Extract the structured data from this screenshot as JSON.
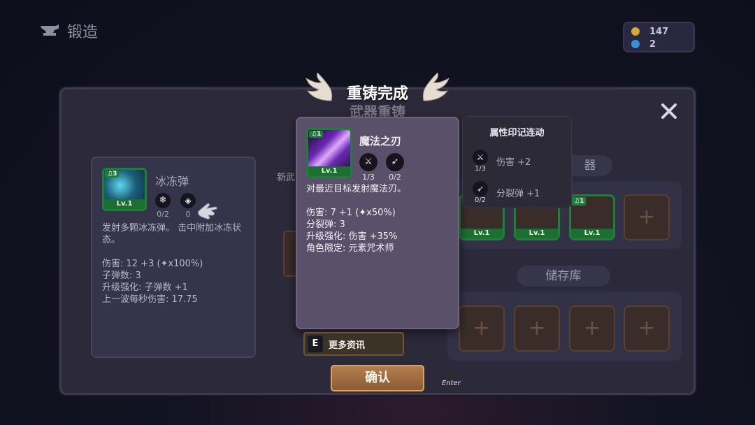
{
  "header": {
    "title": "锻造"
  },
  "currency": {
    "gold": "147",
    "gems": "2",
    "gold_color": "#d4a93a",
    "gem_color": "#3a8fd4"
  },
  "banner": {
    "title": "重铸完成",
    "subtitle": "武器重铸"
  },
  "left_card": {
    "weapon_name": "冰冻弹",
    "badge": "3",
    "level": "Lv.1",
    "mod1_count": "0/2",
    "mod2_count": "0",
    "description": "发射多颗冰冻弹。 击中附加冰冻状态。",
    "stats": [
      "伤害: 12 +3 (✦x100%)",
      "子弹数: 3",
      "升级强化: 子弹数 +1",
      "上一波每秒伤害: 17.75"
    ]
  },
  "new_weapon_label": "新武",
  "detail": {
    "badge": "1",
    "name": "魔法之刃",
    "level": "Lv.1",
    "mod1_count": "1/3",
    "mod2_count": "0/2",
    "description": "对最近目标发射魔法刃。",
    "stats": [
      "伤害: 7 +1 (✦x50%)",
      "分裂弹: 3",
      "升级强化: 伤害 +35%",
      "角色限定: 元素咒术师"
    ]
  },
  "tooltip": {
    "title": "属性印记连动",
    "rows": [
      {
        "icon": "dagger-icon",
        "count": "1/3",
        "label": "伤害 +2"
      },
      {
        "icon": "bow-icon",
        "count": "0/2",
        "label": "分裂弹 +1"
      }
    ]
  },
  "right_panel": {
    "weapons_label_fragment": "器",
    "weapon_slots": [
      {
        "level": "Lv.1"
      },
      {
        "level": "Lv.1"
      },
      {
        "level": "Lv.1",
        "badge": "1"
      }
    ],
    "storage_label": "储存库"
  },
  "buttons": {
    "more_info_key": "E",
    "more_info": "更多资讯",
    "confirm": "确认",
    "enter_hint": "Enter"
  }
}
